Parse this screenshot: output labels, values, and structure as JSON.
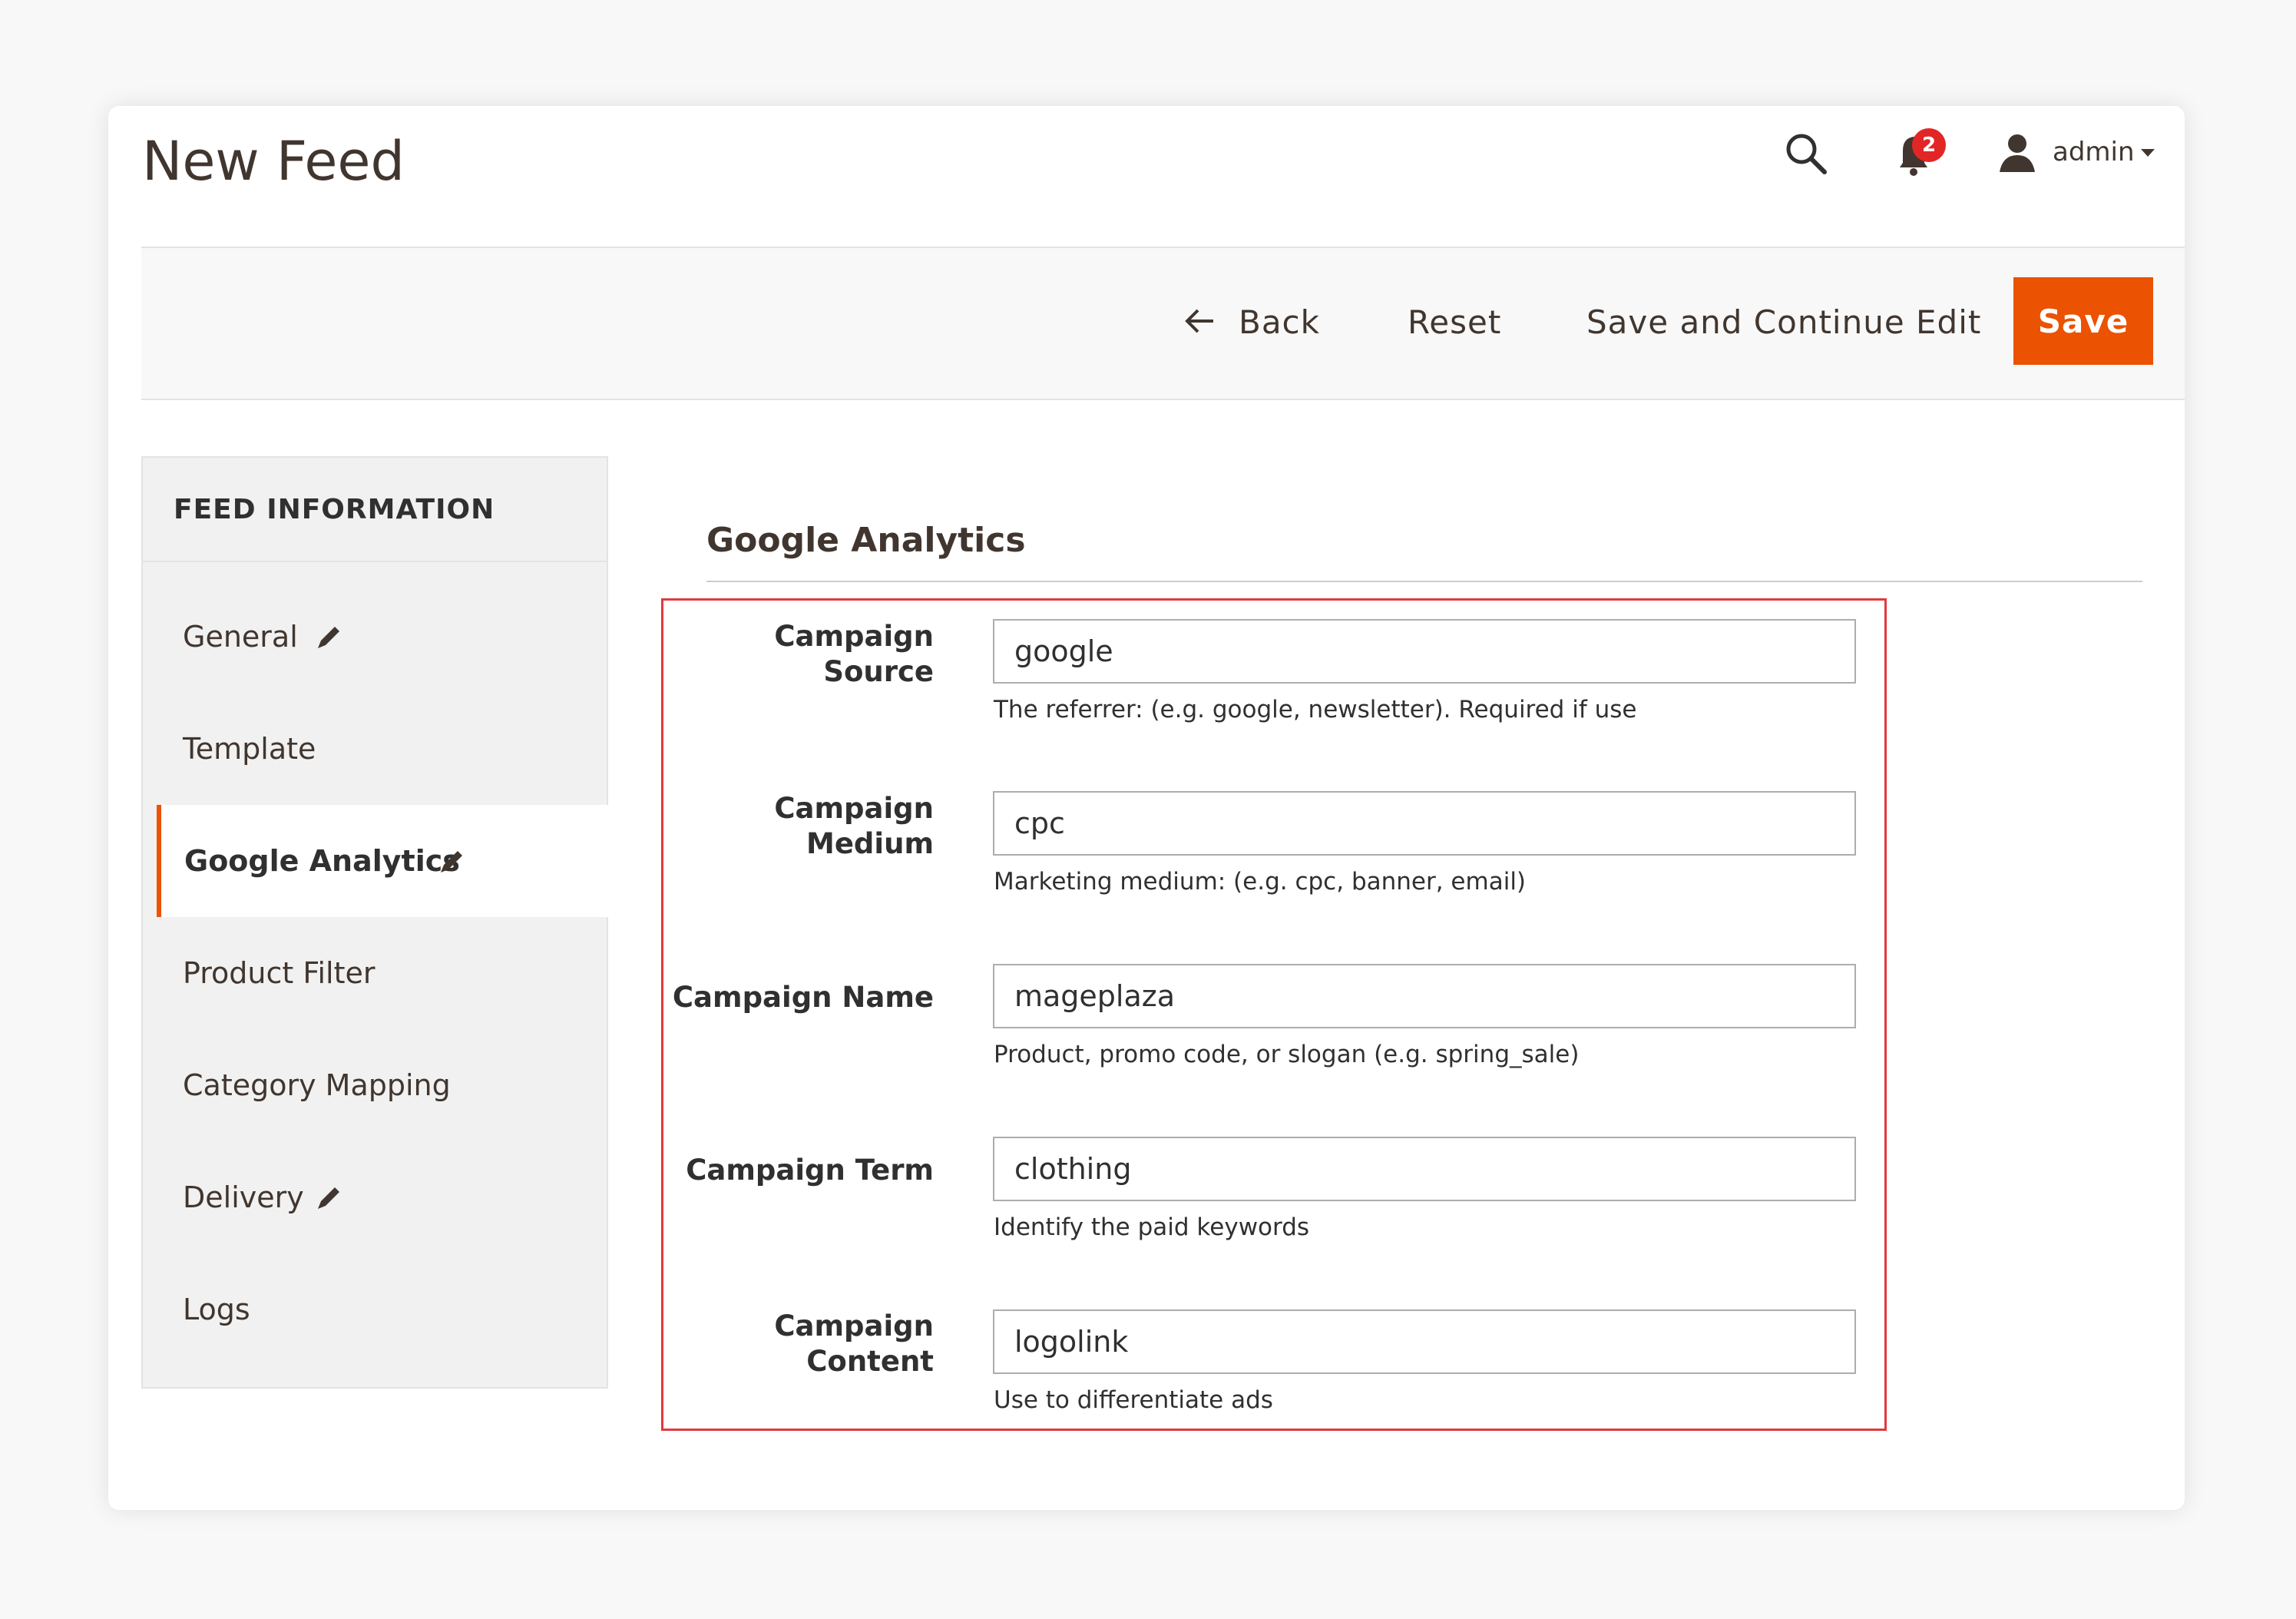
{
  "header": {
    "title": "New Feed",
    "notifications_count": "2",
    "user_label": "admin"
  },
  "toolbar": {
    "back_label": "Back",
    "reset_label": "Reset",
    "save_continue_label": "Save and Continue Edit",
    "save_label": "Save"
  },
  "sidebar": {
    "title": "FEED INFORMATION",
    "items": [
      {
        "label": "General",
        "edited": true
      },
      {
        "label": "Template",
        "edited": false
      },
      {
        "label": "Google Analytics",
        "edited": true,
        "active": true
      },
      {
        "label": "Product Filter",
        "edited": false
      },
      {
        "label": "Category Mapping",
        "edited": false
      },
      {
        "label": "Delivery",
        "edited": true
      },
      {
        "label": "Logs",
        "edited": false
      }
    ]
  },
  "section": {
    "title": "Google Analytics",
    "fields": [
      {
        "label_line1": "Campaign",
        "label_line2": "Source",
        "value": "google",
        "note": "The referrer: (e.g. google, newsletter). Required if use"
      },
      {
        "label_line1": "Campaign",
        "label_line2": "Medium",
        "value": "cpc",
        "note": "Marketing medium: (e.g. cpc, banner, email)"
      },
      {
        "label_line1": "Campaign Name",
        "label_line2": "",
        "value": "mageplaza",
        "note": "Product, promo code, or slogan (e.g. spring_sale)"
      },
      {
        "label_line1": "Campaign Term",
        "label_line2": "",
        "value": "clothing",
        "note": "Identify the paid keywords"
      },
      {
        "label_line1": "Campaign",
        "label_line2": "Content",
        "value": "logolink",
        "note": "Use to differentiate ads"
      }
    ]
  },
  "colors": {
    "accent": "#eb5202",
    "highlight": "#e0393e",
    "badge": "#e22626"
  }
}
